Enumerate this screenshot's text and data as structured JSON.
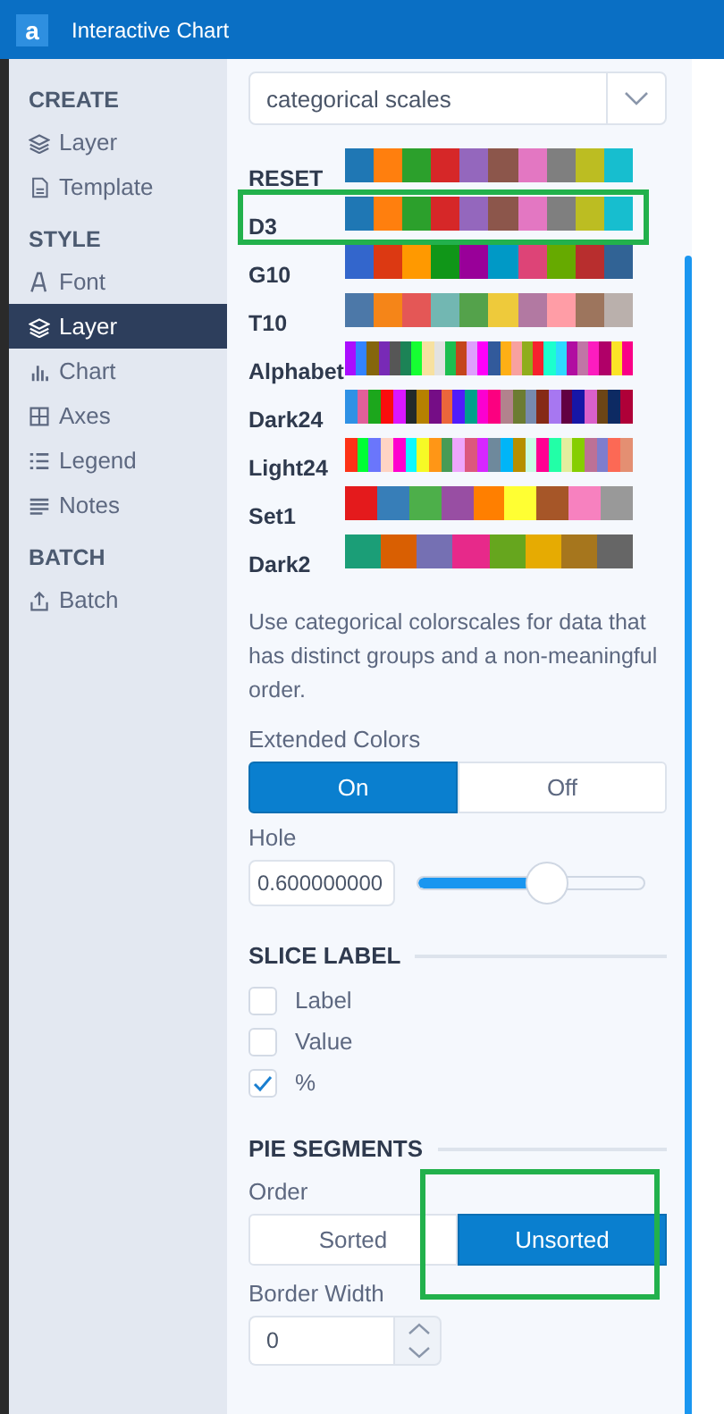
{
  "window": {
    "title": "Interactive Chart",
    "logo": "a"
  },
  "sidebar": {
    "sections": [
      {
        "title": "CREATE",
        "items": [
          {
            "label": "Layer",
            "selected": false
          },
          {
            "label": "Template",
            "selected": false
          }
        ]
      },
      {
        "title": "STYLE",
        "items": [
          {
            "label": "Font",
            "selected": false
          },
          {
            "label": "Layer",
            "selected": true
          },
          {
            "label": "Chart",
            "selected": false
          },
          {
            "label": "Axes",
            "selected": false
          },
          {
            "label": "Legend",
            "selected": false
          },
          {
            "label": "Notes",
            "selected": false
          }
        ]
      },
      {
        "title": "BATCH",
        "items": [
          {
            "label": "Batch",
            "selected": false
          }
        ]
      }
    ]
  },
  "scale_dropdown": {
    "value": "categorical scales"
  },
  "palettes": [
    {
      "name": "RESET",
      "highlighted": false,
      "swatches": [
        {
          "color": "#1f77b4"
        },
        {
          "color": "#ff7f0e"
        },
        {
          "color": "#2ca02c"
        },
        {
          "color": "#d62728"
        },
        {
          "color": "#9467bd"
        },
        {
          "color": "#8c564b"
        },
        {
          "color": "#e377c2"
        },
        {
          "color": "#7f7f7f"
        },
        {
          "color": "#bcbd22"
        },
        {
          "color": "#17becf"
        }
      ]
    },
    {
      "name": "D3",
      "highlighted": true,
      "swatches": [
        {
          "color": "#1f77b4"
        },
        {
          "color": "#ff7f0e"
        },
        {
          "color": "#2ca02c"
        },
        {
          "color": "#d62728"
        },
        {
          "color": "#9467bd"
        },
        {
          "color": "#8c564b"
        },
        {
          "color": "#e377c2"
        },
        {
          "color": "#7f7f7f"
        },
        {
          "color": "#bcbd22"
        },
        {
          "color": "#17becf"
        }
      ]
    },
    {
      "name": "G10",
      "highlighted": false,
      "swatches": [
        {
          "color": "#3366cc"
        },
        {
          "color": "#dc3912"
        },
        {
          "color": "#ff9900"
        },
        {
          "color": "#109618"
        },
        {
          "color": "#990099"
        },
        {
          "color": "#0099c6"
        },
        {
          "color": "#dd4477"
        },
        {
          "color": "#66aa00"
        },
        {
          "color": "#b82e2e"
        },
        {
          "color": "#316395"
        }
      ]
    },
    {
      "name": "T10",
      "highlighted": false,
      "swatches": [
        {
          "color": "#4c78a8"
        },
        {
          "color": "#f58518"
        },
        {
          "color": "#e45756"
        },
        {
          "color": "#72b7b2"
        },
        {
          "color": "#54a24b"
        },
        {
          "color": "#eeca3b"
        },
        {
          "color": "#b279a2"
        },
        {
          "color": "#ff9da6"
        },
        {
          "color": "#9d755d"
        },
        {
          "color": "#bab0ac"
        }
      ]
    },
    {
      "name": "Alphabet",
      "highlighted": false,
      "swatches": [
        {
          "color": "#aa0dfe"
        },
        {
          "color": "#3283fe"
        },
        {
          "color": "#85660d"
        },
        {
          "color": "#782ab6"
        },
        {
          "color": "#565656"
        },
        {
          "color": "#1c8356"
        },
        {
          "color": "#16ff32"
        },
        {
          "color": "#f7e1a0"
        },
        {
          "color": "#e2e2e2"
        },
        {
          "color": "#1cbe4f"
        },
        {
          "color": "#c4451c"
        },
        {
          "color": "#dea0fd"
        },
        {
          "color": "#fe00fa"
        },
        {
          "color": "#325a9b"
        },
        {
          "color": "#feaf16"
        },
        {
          "color": "#f8a19f"
        },
        {
          "color": "#90ad1c"
        },
        {
          "color": "#f6222e"
        },
        {
          "color": "#1cffce"
        },
        {
          "color": "#2ed9ff"
        },
        {
          "color": "#b10da1"
        },
        {
          "color": "#c075a6"
        },
        {
          "color": "#fc1cbf"
        },
        {
          "color": "#b00068"
        },
        {
          "color": "#fbe426"
        },
        {
          "color": "#fa0087"
        }
      ]
    },
    {
      "name": "Dark24",
      "highlighted": false,
      "swatches": [
        {
          "color": "#2e91e5"
        },
        {
          "color": "#e15f99"
        },
        {
          "color": "#1ca71c"
        },
        {
          "color": "#fb0d0d"
        },
        {
          "color": "#da16ff"
        },
        {
          "color": "#222a2a"
        },
        {
          "color": "#b68100"
        },
        {
          "color": "#750d86"
        },
        {
          "color": "#eb663b"
        },
        {
          "color": "#511cfb"
        },
        {
          "color": "#00a08b"
        },
        {
          "color": "#fb00d1"
        },
        {
          "color": "#fc0080"
        },
        {
          "color": "#b2828d"
        },
        {
          "color": "#6c7c32"
        },
        {
          "color": "#778aae"
        },
        {
          "color": "#862a16"
        },
        {
          "color": "#a777f1"
        },
        {
          "color": "#620042"
        },
        {
          "color": "#1616a7"
        },
        {
          "color": "#da60ca"
        },
        {
          "color": "#6c4516"
        },
        {
          "color": "#0d2a63"
        },
        {
          "color": "#af0038"
        }
      ]
    },
    {
      "name": "Light24",
      "highlighted": false,
      "swatches": [
        {
          "color": "#fd3216"
        },
        {
          "color": "#00fe35"
        },
        {
          "color": "#6a76fc"
        },
        {
          "color": "#fed4c4"
        },
        {
          "color": "#fe00ce"
        },
        {
          "color": "#0df9ff"
        },
        {
          "color": "#f6f926"
        },
        {
          "color": "#ff9616"
        },
        {
          "color": "#479b55"
        },
        {
          "color": "#eea6fb"
        },
        {
          "color": "#dc587d"
        },
        {
          "color": "#d626ff"
        },
        {
          "color": "#6e899c"
        },
        {
          "color": "#00b5f7"
        },
        {
          "color": "#b68e00"
        },
        {
          "color": "#c9fbe5"
        },
        {
          "color": "#ff0092"
        },
        {
          "color": "#22ffa7"
        },
        {
          "color": "#e3ee9e"
        },
        {
          "color": "#86ce00"
        },
        {
          "color": "#bc7196"
        },
        {
          "color": "#7e7dcd"
        },
        {
          "color": "#fc6955"
        },
        {
          "color": "#e48f72"
        }
      ]
    },
    {
      "name": "Set1",
      "highlighted": false,
      "swatches": [
        {
          "color": "#e41a1c"
        },
        {
          "color": "#377eb8"
        },
        {
          "color": "#4daf4a"
        },
        {
          "color": "#984ea3"
        },
        {
          "color": "#ff7f00"
        },
        {
          "color": "#ffff33"
        },
        {
          "color": "#a65628"
        },
        {
          "color": "#f781bf"
        },
        {
          "color": "#999999"
        }
      ]
    },
    {
      "name": "Dark2",
      "highlighted": false,
      "swatches": [
        {
          "color": "#1b9e77"
        },
        {
          "color": "#d95f02"
        },
        {
          "color": "#7570b3"
        },
        {
          "color": "#e7298a"
        },
        {
          "color": "#66a61e"
        },
        {
          "color": "#e6ab02"
        },
        {
          "color": "#a6761d"
        },
        {
          "color": "#666666"
        }
      ]
    }
  ],
  "description": "Use categorical colorscales for data that has distinct groups and a non-meaningful order.",
  "extended_colors": {
    "label": "Extended Colors",
    "options": [
      {
        "label": "On",
        "selected": true
      },
      {
        "label": "Off",
        "selected": false
      }
    ]
  },
  "hole": {
    "label": "Hole",
    "value": "0.600000000",
    "level": 0.58
  },
  "slice_label": {
    "title": "SLICE LABEL",
    "options": [
      {
        "label": "Label",
        "checked": false
      },
      {
        "label": "Value",
        "checked": false
      },
      {
        "label": "%",
        "checked": true
      }
    ]
  },
  "pie_segments": {
    "title": "PIE SEGMENTS",
    "order": {
      "label": "Order",
      "highlighted": true,
      "options": [
        {
          "label": "Sorted",
          "selected": false
        },
        {
          "label": "Unsorted",
          "selected": true
        }
      ]
    },
    "border_width": {
      "label": "Border Width",
      "value": "0"
    }
  }
}
